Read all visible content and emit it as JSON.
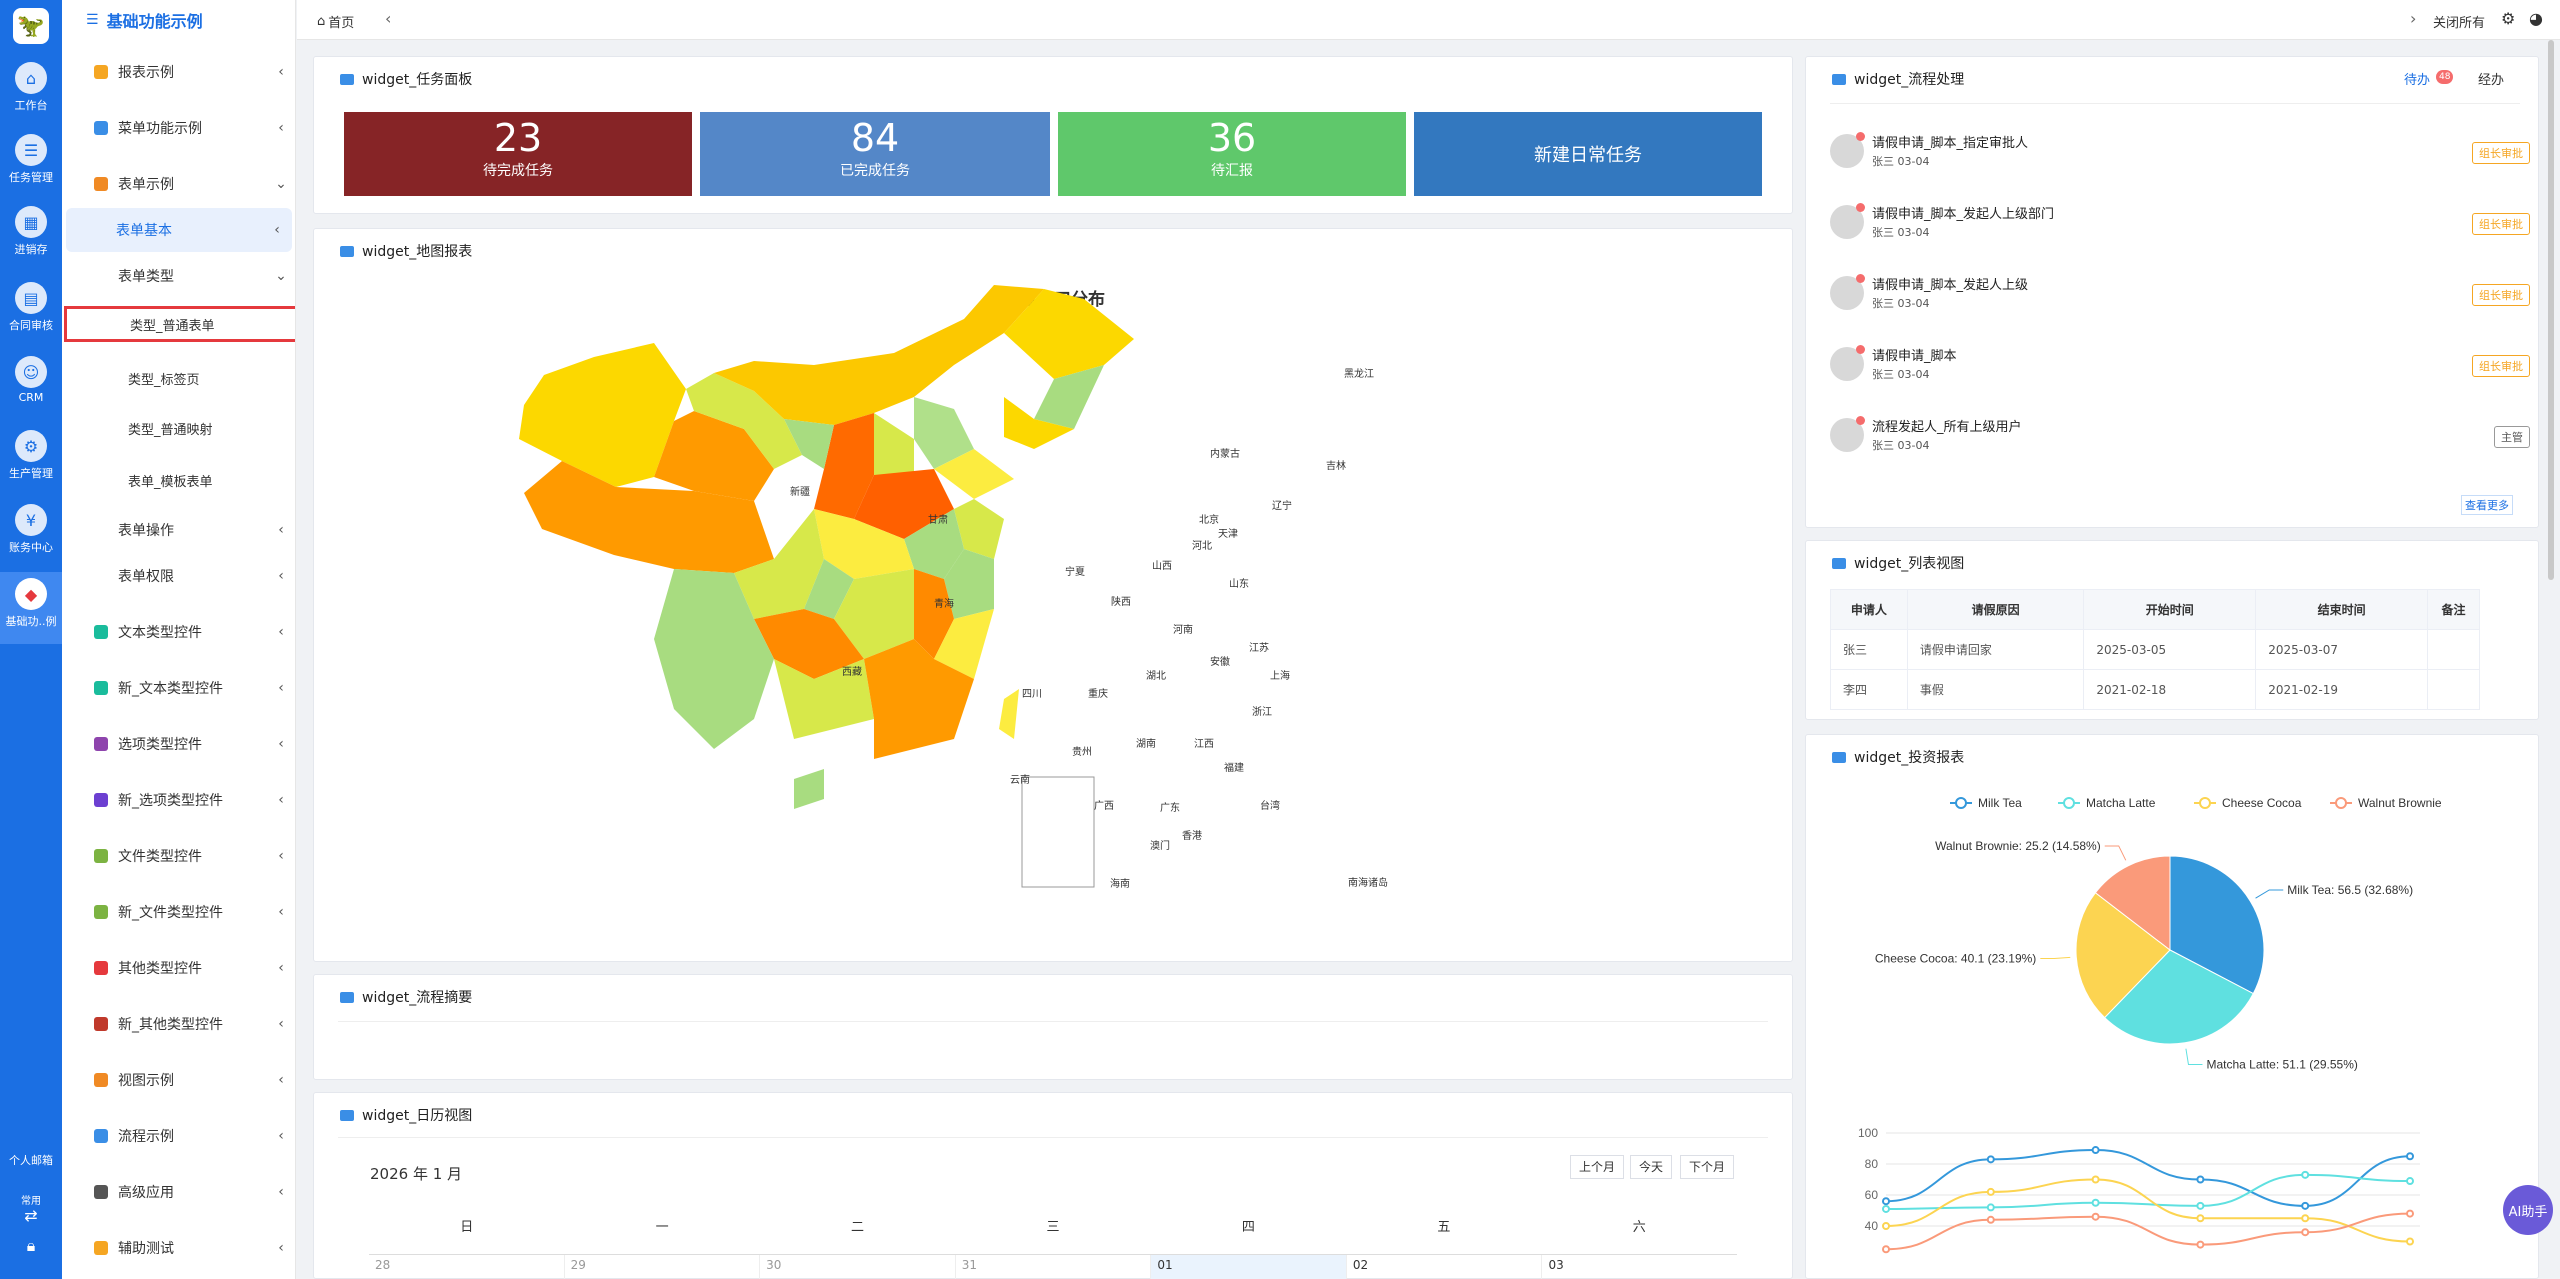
{
  "rail": {
    "items": [
      {
        "label": "工作台",
        "icon": "home-icon"
      },
      {
        "label": "任务管理",
        "icon": "task-icon"
      },
      {
        "label": "进销存",
        "icon": "inventory-icon"
      },
      {
        "label": "合同审核",
        "icon": "contract-icon"
      },
      {
        "label": "CRM",
        "icon": "crm-icon"
      },
      {
        "label": "生产管理",
        "icon": "production-icon"
      },
      {
        "label": "账务中心",
        "icon": "finance-icon"
      },
      {
        "label": "基础功..例",
        "icon": "basic-icon"
      }
    ],
    "mailbox": "个人邮箱",
    "common": "常用"
  },
  "menu": {
    "title": "基础功能示例",
    "items": [
      "报表示例",
      "菜单功能示例",
      "表单示例",
      "表单基本",
      "表单类型",
      "类型_普通表单",
      "类型_标签页",
      "类型_普通映射",
      "表单_模板表单",
      "表单操作",
      "表单权限",
      "文本类型控件",
      "新_文本类型控件",
      "选项类型控件",
      "新_选项类型控件",
      "文件类型控件",
      "新_文件类型控件",
      "其他类型控件",
      "新_其他类型控件",
      "视图示例",
      "流程示例",
      "高级应用",
      "辅助测试"
    ]
  },
  "topbar": {
    "home": "首页",
    "close_all": "关闭所有"
  },
  "task_panel": {
    "title": "widget_任务面板",
    "stats": [
      {
        "value": "23",
        "label": "待完成任务"
      },
      {
        "value": "84",
        "label": "已完成任务"
      },
      {
        "value": "36",
        "label": "待汇报"
      }
    ],
    "new_task": "新建日常任务"
  },
  "map_panel": {
    "title": "widget_地图报表",
    "map_title": "各省人口分布",
    "provinces": [
      "新疆",
      "西藏",
      "青海",
      "甘肃",
      "内蒙古",
      "黑龙江",
      "吉林",
      "辽宁",
      "北京",
      "天津",
      "河北",
      "山西",
      "宁夏",
      "陕西",
      "河南",
      "山东",
      "江苏",
      "上海",
      "安徽",
      "湖北",
      "四川",
      "重庆",
      "浙江",
      "贵州",
      "湖南",
      "江西",
      "福建",
      "台湾",
      "云南",
      "广西",
      "广东",
      "香港",
      "澳门",
      "海南"
    ],
    "south_sea": "南海诸岛"
  },
  "summary_panel": {
    "title": "widget_流程摘要"
  },
  "calendar_panel": {
    "title": "widget_日历视图",
    "month": "2026 年 1 月",
    "buttons": [
      "上个月",
      "今天",
      "下个月"
    ],
    "weekdays": [
      "日",
      "一",
      "二",
      "三",
      "四",
      "五",
      "六"
    ],
    "days": [
      "28",
      "29",
      "30",
      "31",
      "01",
      "02",
      "03"
    ]
  },
  "flow_panel": {
    "title": "widget_流程处理",
    "tab_todo": "待办",
    "badge": "48",
    "tab_done": "经办",
    "items": [
      {
        "title": "请假申请_脚本_指定审批人",
        "sub": "张三 03-04",
        "tag": "组长审批"
      },
      {
        "title": "请假申请_脚本_发起人上级部门",
        "sub": "张三 03-04",
        "tag": "组长审批"
      },
      {
        "title": "请假申请_脚本_发起人上级",
        "sub": "张三 03-04",
        "tag": "组长审批"
      },
      {
        "title": "请假申请_脚本",
        "sub": "张三 03-04",
        "tag": "组长审批"
      },
      {
        "title": "流程发起人_所有上级用户",
        "sub": "张三 03-04",
        "tag": "主管"
      }
    ],
    "more": "查看更多"
  },
  "list_panel": {
    "title": "widget_列表视图",
    "headers": [
      "申请人",
      "请假原因",
      "开始时间",
      "结束时间",
      "备注"
    ],
    "rows": [
      [
        "张三",
        "请假申请回家",
        "2025-03-05",
        "2025-03-07",
        ""
      ],
      [
        "李四",
        "事假",
        "2021-02-18",
        "2021-02-19",
        ""
      ]
    ]
  },
  "invest_panel": {
    "title": "widget_投资报表"
  },
  "ai_button": "AI助手",
  "chart_data": [
    {
      "type": "pie",
      "series": [
        {
          "name": "Milk Tea",
          "value": 56.5,
          "label": "Milk Tea: 56.5 (32.68%)"
        },
        {
          "name": "Matcha Latte",
          "value": 51.1,
          "label": "Matcha Latte: 51.1 (29.55%)"
        },
        {
          "name": "Cheese Cocoa",
          "value": 40.1,
          "label": "Cheese Cocoa: 40.1 (23.19%)"
        },
        {
          "name": "Walnut Brownie",
          "value": 25.2,
          "label": "Walnut Brownie: 25.2 (14.58%)"
        }
      ],
      "colors": [
        "#3498db",
        "#5fe0e0",
        "#fcd451",
        "#fa9a7a"
      ],
      "legend": "top"
    },
    {
      "type": "line",
      "yticks": [
        "100",
        "80",
        "60",
        "40"
      ],
      "ylim": [
        20,
        100
      ],
      "series": [
        {
          "name": "Milk Tea",
          "color": "#3498db",
          "values": [
            56,
            83,
            89,
            70,
            53,
            85
          ]
        },
        {
          "name": "Matcha Latte",
          "color": "#5fe0e0",
          "values": [
            51,
            52,
            55,
            53,
            73,
            69
          ]
        },
        {
          "name": "Cheese Cocoa",
          "color": "#fcd451",
          "values": [
            40,
            62,
            70,
            45,
            45,
            30
          ]
        },
        {
          "name": "Walnut Brownie",
          "color": "#fa9a7a",
          "values": [
            25,
            44,
            46,
            28,
            36,
            48
          ]
        }
      ]
    }
  ]
}
